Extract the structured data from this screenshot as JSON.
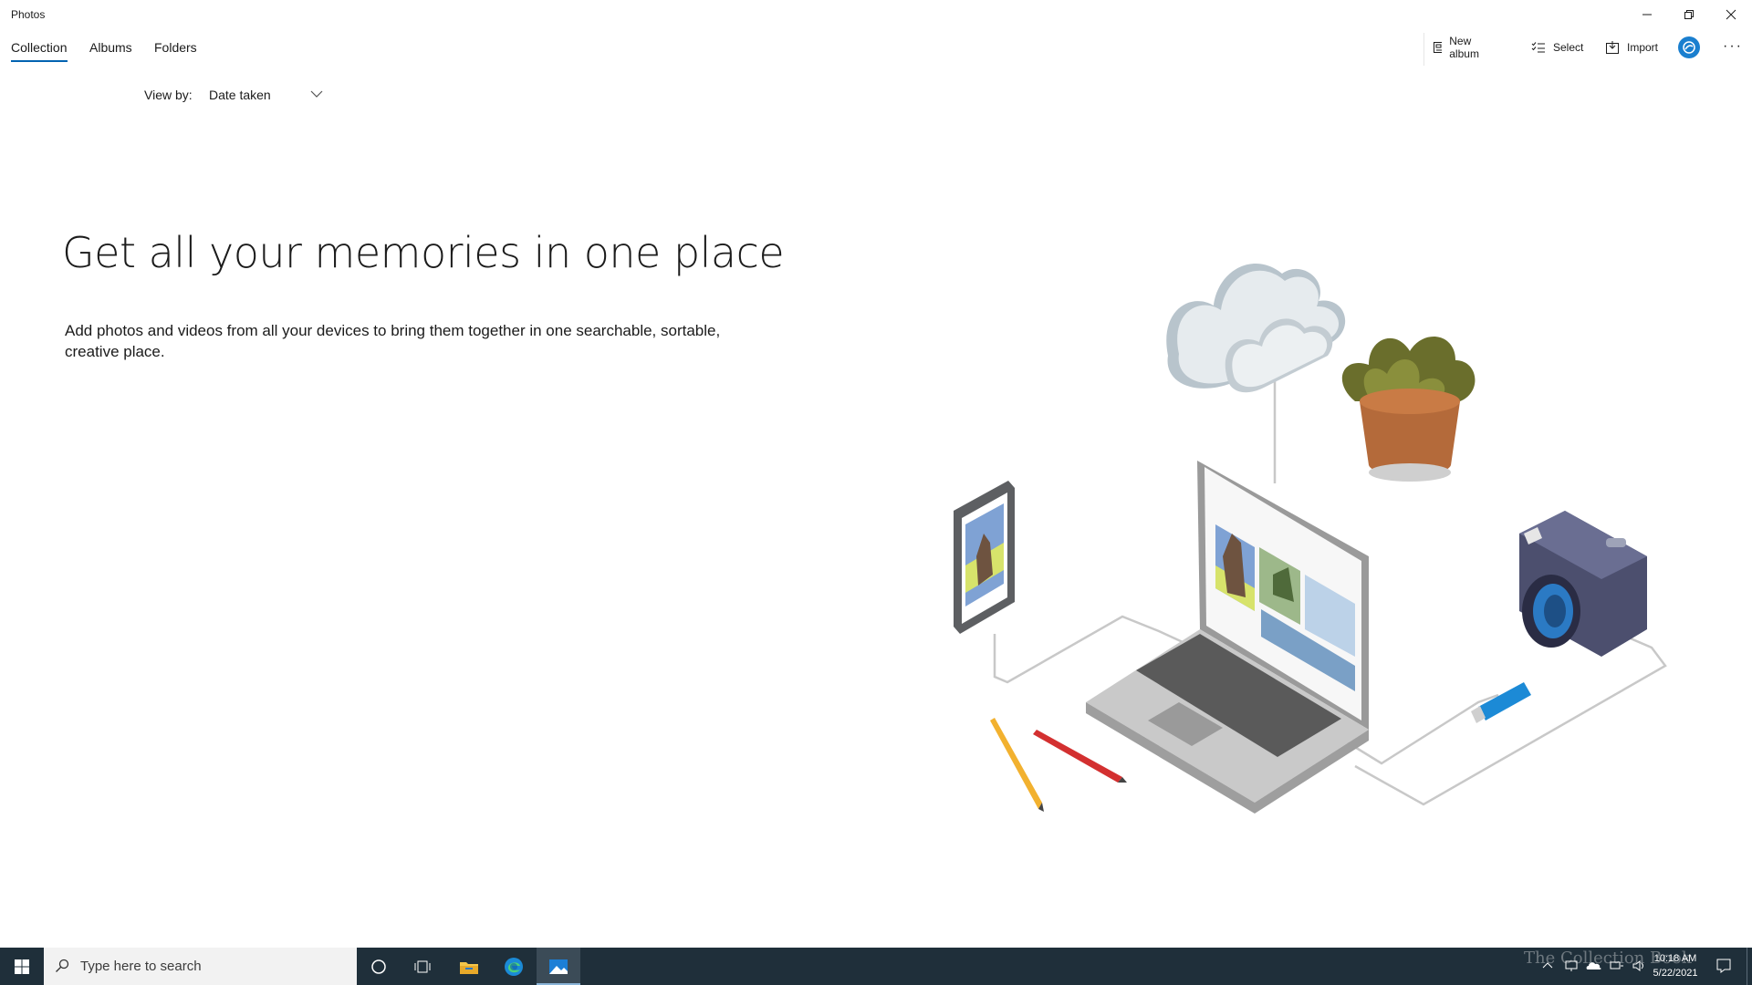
{
  "window": {
    "title": "Photos"
  },
  "nav": {
    "tabs": [
      {
        "label": "Collection"
      },
      {
        "label": "Albums"
      },
      {
        "label": "Folders"
      }
    ]
  },
  "toolbar": {
    "new_album_label": "New album",
    "select_label": "Select",
    "import_label": "Import",
    "more_label": "···"
  },
  "view_by": {
    "label": "View by:",
    "selected": "Date taken"
  },
  "hero": {
    "title": "Get all your memories in one place",
    "body": "Add photos and videos from all your devices to bring them together in one searchable, sortable, creative place."
  },
  "taskbar": {
    "search_placeholder": "Type here to search",
    "time": "10:18 AM",
    "date": "5/22/2021",
    "watermark": "The Collection Book"
  },
  "colors": {
    "accent": "#0063b1",
    "taskbar": "#1f2f3a"
  },
  "icons": [
    "minimize-icon",
    "maximize-icon",
    "close-icon",
    "new-album-icon",
    "select-icon",
    "import-icon",
    "onedrive-avatar-icon",
    "more-icon",
    "chevron-down-icon",
    "windows-start-icon",
    "search-icon",
    "cortana-icon",
    "task-view-icon",
    "file-explorer-icon",
    "edge-icon",
    "photos-icon",
    "notification-icon"
  ]
}
